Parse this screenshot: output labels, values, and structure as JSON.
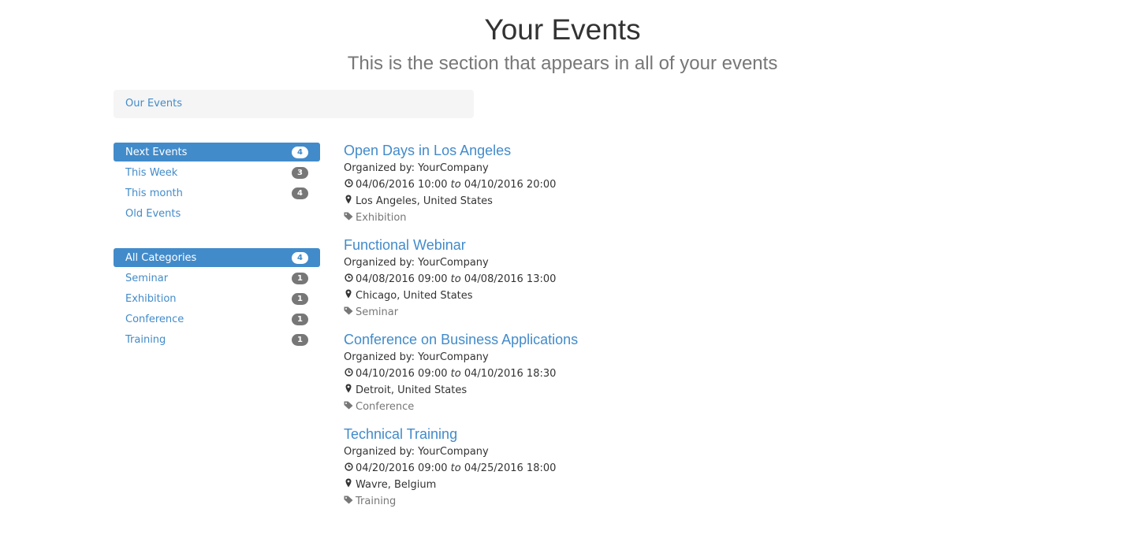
{
  "header": {
    "title": "Your Events",
    "subtitle": "This is the section that appears in all of your events"
  },
  "breadcrumb": {
    "label": "Our Events"
  },
  "date_filters": [
    {
      "label": "Next Events",
      "count": "4",
      "active": true
    },
    {
      "label": "This Week",
      "count": "3",
      "active": false
    },
    {
      "label": "This month",
      "count": "4",
      "active": false
    },
    {
      "label": "Old Events",
      "count": "",
      "active": false
    }
  ],
  "category_filters": [
    {
      "label": "All Categories",
      "count": "4",
      "active": true
    },
    {
      "label": "Seminar",
      "count": "1",
      "active": false
    },
    {
      "label": "Exhibition",
      "count": "1",
      "active": false
    },
    {
      "label": "Conference",
      "count": "1",
      "active": false
    },
    {
      "label": "Training",
      "count": "1",
      "active": false
    }
  ],
  "labels": {
    "range_separator": "to"
  },
  "events": [
    {
      "title": "Open Days in Los Angeles",
      "organizer": "Organized by: YourCompany",
      "start": "04/06/2016 10:00",
      "end": "04/10/2016 20:00",
      "location": "Los Angeles, United States",
      "tag": "Exhibition"
    },
    {
      "title": "Functional Webinar",
      "organizer": "Organized by: YourCompany",
      "start": "04/08/2016 09:00",
      "end": "04/08/2016 13:00",
      "location": "Chicago, United States",
      "tag": "Seminar"
    },
    {
      "title": "Conference on Business Applications",
      "organizer": "Organized by: YourCompany",
      "start": "04/10/2016 09:00",
      "end": "04/10/2016 18:30",
      "location": "Detroit, United States",
      "tag": "Conference"
    },
    {
      "title": "Technical Training",
      "organizer": "Organized by: YourCompany",
      "start": "04/20/2016 09:00",
      "end": "04/25/2016 18:00",
      "location": "Wavre, Belgium",
      "tag": "Training"
    }
  ],
  "icons": {
    "clock": "clock-icon",
    "location": "map-marker-icon",
    "tag": "tag-icon"
  },
  "colors": {
    "link": "#428bca",
    "active_bg": "#428bca",
    "badge_bg": "#777777",
    "muted": "#777777"
  }
}
